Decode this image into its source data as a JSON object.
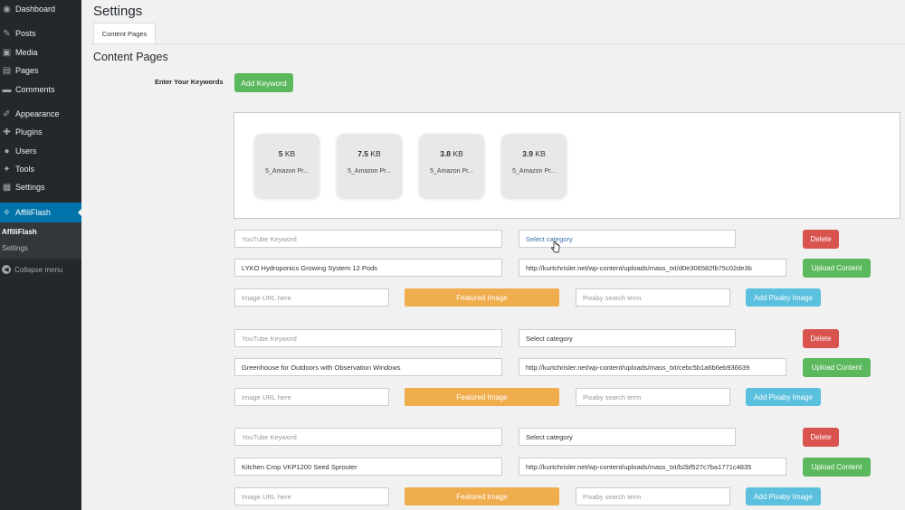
{
  "sidebar": {
    "items": [
      {
        "label": "Dashboard",
        "icon": "dashboard-icon",
        "glyph": "◉"
      },
      {
        "label": "Posts",
        "icon": "pushpin-icon",
        "glyph": "✎"
      },
      {
        "label": "Media",
        "icon": "media-icon",
        "glyph": "▣"
      },
      {
        "label": "Pages",
        "icon": "pages-icon",
        "glyph": "▤"
      },
      {
        "label": "Comments",
        "icon": "comments-icon",
        "glyph": "▬"
      },
      {
        "label": "Appearance",
        "icon": "paintbrush-icon",
        "glyph": "✐"
      },
      {
        "label": "Plugins",
        "icon": "plugin-icon",
        "glyph": "✚"
      },
      {
        "label": "Users",
        "icon": "users-icon",
        "glyph": "●"
      },
      {
        "label": "Tools",
        "icon": "wrench-icon",
        "glyph": "✦"
      },
      {
        "label": "Settings",
        "icon": "settings-icon",
        "glyph": "▦"
      }
    ],
    "active": {
      "label": "AffiliFlash",
      "icon": "affiliflash-icon",
      "glyph": "✧"
    },
    "submenu": {
      "title": "AffiliFlash",
      "settings": "Settings"
    },
    "collapse": "Collapse menu"
  },
  "header": {
    "title": "Settings",
    "tab": "Content Pages"
  },
  "section": {
    "title": "Content Pages",
    "keywords_label": "Enter Your Keywords",
    "add_keyword": "Add Keyword"
  },
  "files": [
    {
      "size": "5",
      "unit": "KB",
      "name": "5_Amazon Pr..."
    },
    {
      "size": "7.5",
      "unit": "KB",
      "name": "5_Amazon Pr..."
    },
    {
      "size": "3.8",
      "unit": "KB",
      "name": "5_Amazon Pr..."
    },
    {
      "size": "3.9",
      "unit": "KB",
      "name": "5_Amazon Pr..."
    }
  ],
  "rows": [
    {
      "youtube_placeholder": "YouTube Keyword",
      "category": "Select category",
      "delete": "Delete",
      "title": "LYKO Hydroponics Growing System 12 Pods",
      "url": "http://kurtchrisler.net/wp-content/uploads/mass_txt/d0e306582fb75c02de3b",
      "upload": "Upload Content",
      "image_placeholder": "Image URL here",
      "featured": "Featured Image",
      "pixabay_placeholder": "Pixaby search term",
      "add_pixabay": "Add Pixaby Image"
    },
    {
      "youtube_placeholder": "YouTube Keyword",
      "category": "Select category",
      "delete": "Delete",
      "title": "Greenhouse for Outdoors with Observation Windows",
      "url": "http://kurtchrisler.net/wp-content/uploads/mass_txt/cebc5b1a6b6eb936639",
      "upload": "Upload Content",
      "image_placeholder": "Image URL here",
      "featured": "Featured Image",
      "pixabay_placeholder": "Pixaby search term",
      "add_pixabay": "Add Pixaby Image"
    },
    {
      "youtube_placeholder": "YouTube Keyword",
      "category": "Select category",
      "delete": "Delete",
      "title": "Kitchen Crop VKP1200 Seed Sprouter",
      "url": "http://kurtchrisler.net/wp-content/uploads/mass_txt/b2bf527c7ba1771c4835",
      "upload": "Upload Content",
      "image_placeholder": "Image URL here",
      "featured": "Featured Image",
      "pixabay_placeholder": "Pixaby search term",
      "add_pixabay": "Add Pixaby Image"
    }
  ]
}
